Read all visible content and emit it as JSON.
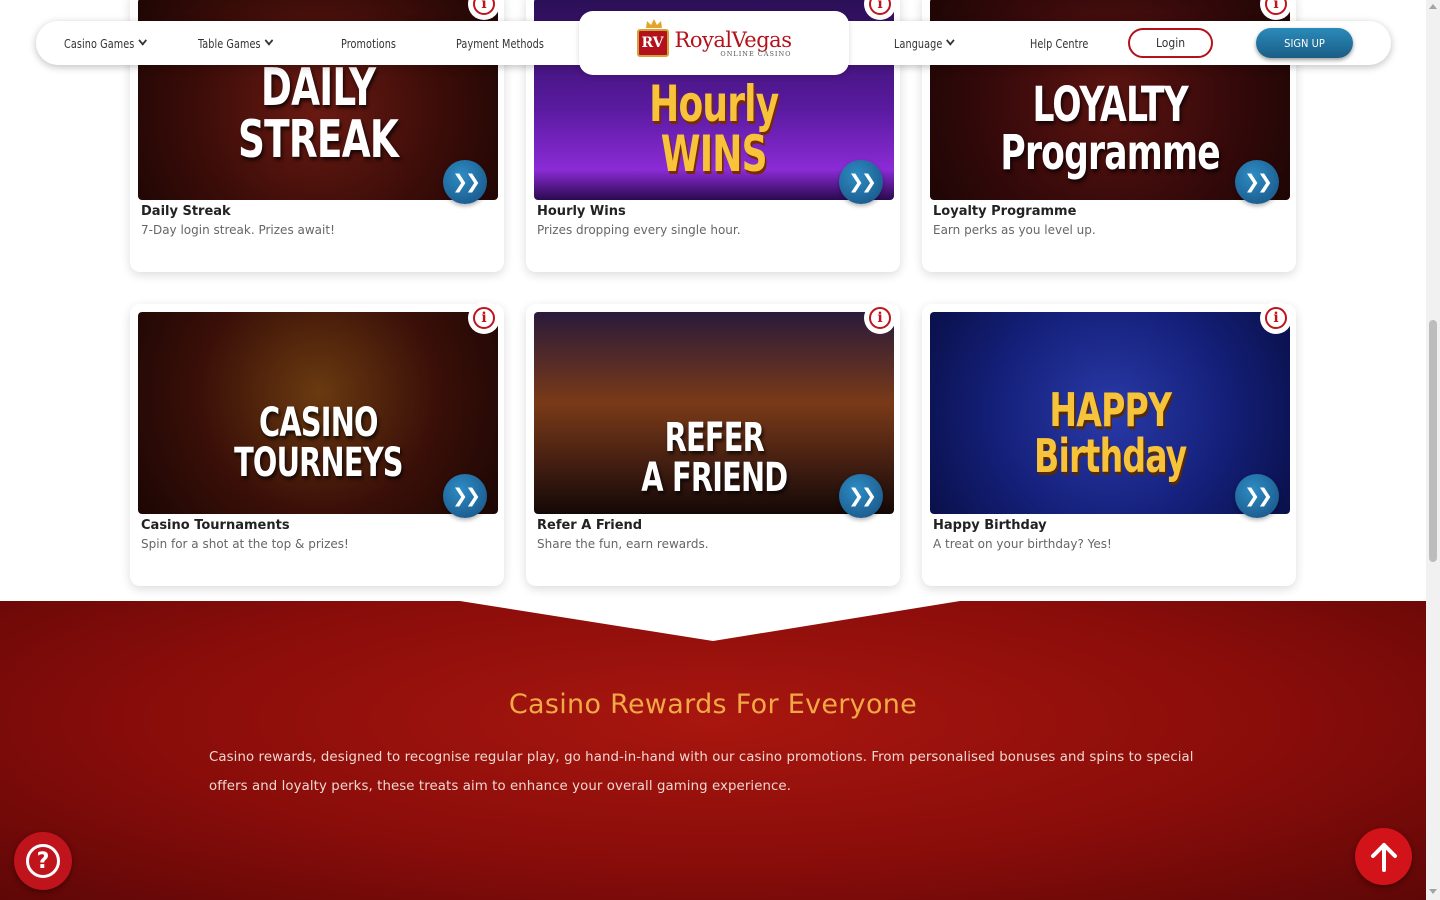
{
  "nav": {
    "casino_games": "Casino Games",
    "table_games": "Table Games",
    "promotions": "Promotions",
    "payment_methods": "Payment Methods",
    "language": "Language",
    "help_centre": "Help Centre",
    "login": "Login",
    "signup": "SIGN UP"
  },
  "logo": {
    "mark": "RV",
    "name": "RoyalVegas",
    "sub": "ONLINE CASINO"
  },
  "cards": [
    {
      "art": "DAILY\nSTREAK",
      "title": "Daily Streak",
      "desc": "7-Day login streak. Prizes await!"
    },
    {
      "art": "Hourly\nWINS",
      "title": "Hourly Wins",
      "desc": "Prizes dropping every single hour."
    },
    {
      "art": "LOYALTY\nProgramme",
      "title": "Loyalty Programme",
      "desc": "Earn perks as you level up."
    },
    {
      "art": "CASINO\nTOURNEYS",
      "title": "Casino Tournaments",
      "desc": "Spin for a shot at the top & prizes!"
    },
    {
      "art": "REFER\nA FRIEND",
      "title": "Refer A Friend",
      "desc": "Share the fun, earn rewards."
    },
    {
      "art": "HAPPY\nBirthday",
      "title": "Happy Birthday",
      "desc": "A treat on your birthday? Yes!"
    }
  ],
  "card_icons": {
    "info": "i",
    "more": "❯❯"
  },
  "rewards": {
    "title": "Casino Rewards For Everyone",
    "body": "Casino rewards, designed to recognise regular play, go hand-in-hand with our casino promotions. From personalised bonuses and spins to special offers and loyalty perks, these treats aim to enhance your overall gaming experience."
  },
  "help_icon": "?",
  "colors": {
    "brand_red": "#c0141d",
    "accent_gold": "#f2a945",
    "signup_blue": "#1a5d86"
  }
}
